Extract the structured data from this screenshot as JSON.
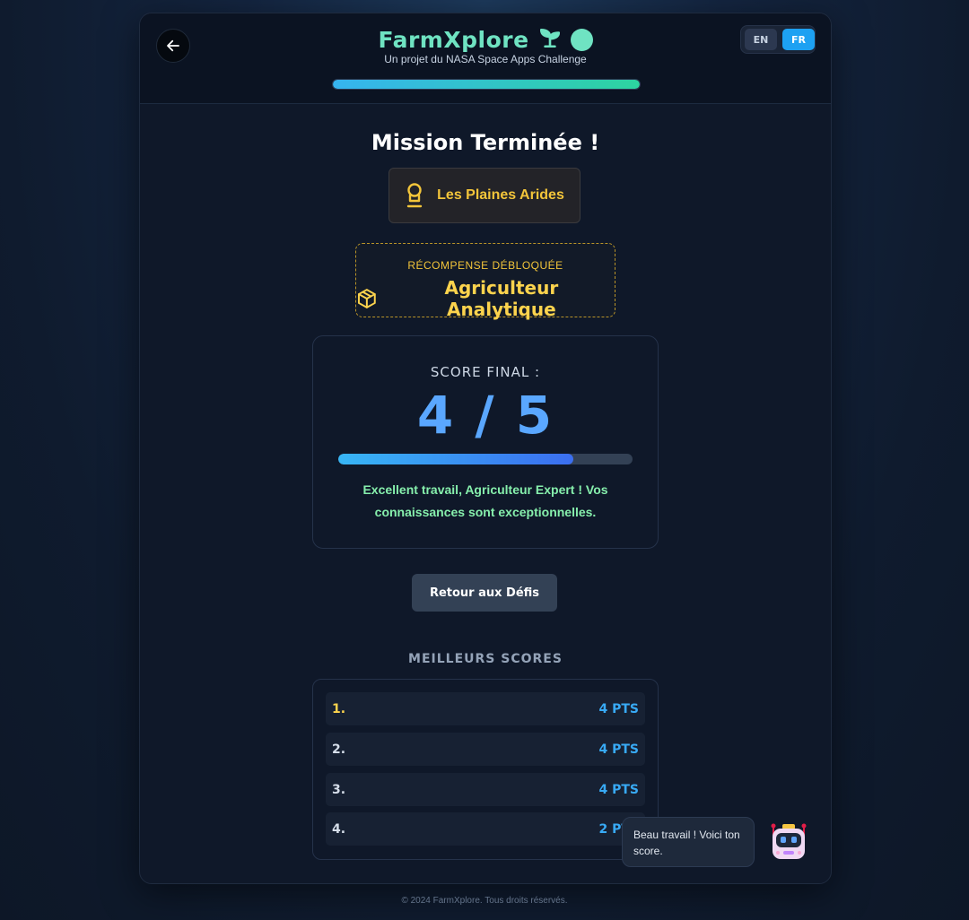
{
  "header": {
    "title": "FarmXplore",
    "subtitle": "Un projet du NASA Space Apps Challenge",
    "progress": 1.0,
    "lang": {
      "en": "EN",
      "fr": "FR",
      "active": "FR"
    },
    "back_icon": "arrow-left-icon",
    "title_icons": [
      "sprout-icon",
      "circle-icon"
    ]
  },
  "mission": {
    "title": "Mission Terminée !",
    "location": "Les Plaines Arides",
    "location_icon": "medal-icon"
  },
  "reward": {
    "caption": "RÉCOMPENSE DÉBLOQUÉE",
    "name": "Agriculteur Analytique",
    "icon": "box-icon"
  },
  "score": {
    "label": "SCORE FINAL :",
    "display": "4 / 5",
    "value": 4,
    "max": 5,
    "message": "Excellent travail, Agriculteur Expert ! Vos connaissances sont exceptionnelles."
  },
  "actions": {
    "return_label": "Retour aux Défis"
  },
  "best_scores": {
    "title": "MEILLEURS SCORES",
    "rows": [
      {
        "rank": "1.",
        "points": "4 PTS"
      },
      {
        "rank": "2.",
        "points": "4 PTS"
      },
      {
        "rank": "3.",
        "points": "4 PTS"
      },
      {
        "rank": "4.",
        "points": "2 PTS"
      }
    ]
  },
  "assistant": {
    "message": "Beau travail ! Voici ton score.",
    "icon": "robot-icon"
  },
  "footer": {
    "text": "© 2024 FarmXplore. Tous droits réservés."
  },
  "colors": {
    "accent_teal": "#6fe3c2",
    "gold": "#fcd34d",
    "score_blue": "#5aa7ff",
    "success_green": "#86efac"
  }
}
